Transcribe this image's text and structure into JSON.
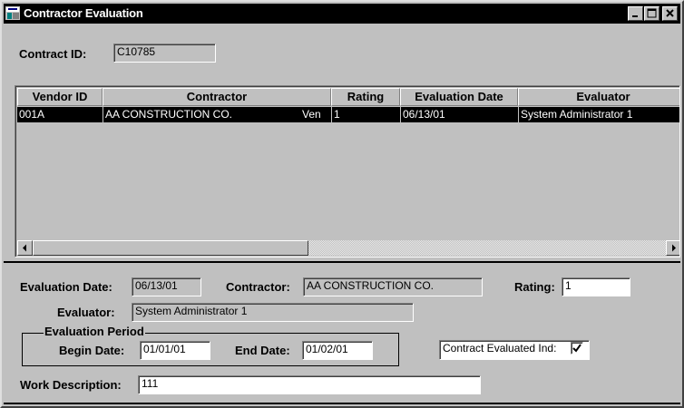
{
  "window": {
    "title": "Contractor Evaluation"
  },
  "contract": {
    "label": "Contract ID:",
    "value": "C10785"
  },
  "grid": {
    "columns": [
      "Vendor ID",
      "Contractor",
      "Rating",
      "Evaluation Date",
      "Evaluator"
    ],
    "rows": [
      {
        "vendor_id": "001A",
        "contractor": "AA CONSTRUCTION CO.",
        "contractor_suffix": "Ven",
        "rating": "1",
        "evaluation_date": "06/13/01",
        "evaluator": "System Administrator 1"
      }
    ]
  },
  "details": {
    "evaluation_date": {
      "label": "Evaluation Date:",
      "value": "06/13/01"
    },
    "contractor": {
      "label": "Contractor:",
      "value": "AA CONSTRUCTION CO."
    },
    "rating": {
      "label": "Rating:",
      "value": "1"
    },
    "evaluator": {
      "label": "Evaluator:",
      "value": "System Administrator 1"
    },
    "evaluation_period": {
      "legend": "Evaluation Period",
      "begin_date": {
        "label": "Begin Date:",
        "value": "01/01/01"
      },
      "end_date": {
        "label": "End Date:",
        "value": "01/02/01"
      }
    },
    "contract_evaluated": {
      "label": "Contract Evaluated Ind:",
      "checked": true
    },
    "work_description": {
      "label": "Work Description:",
      "value": "111"
    }
  },
  "icons": [
    "app-icon",
    "minimize-icon",
    "maximize-icon",
    "close-icon",
    "scroll-left-icon",
    "scroll-right-icon",
    "checkmark-icon"
  ]
}
